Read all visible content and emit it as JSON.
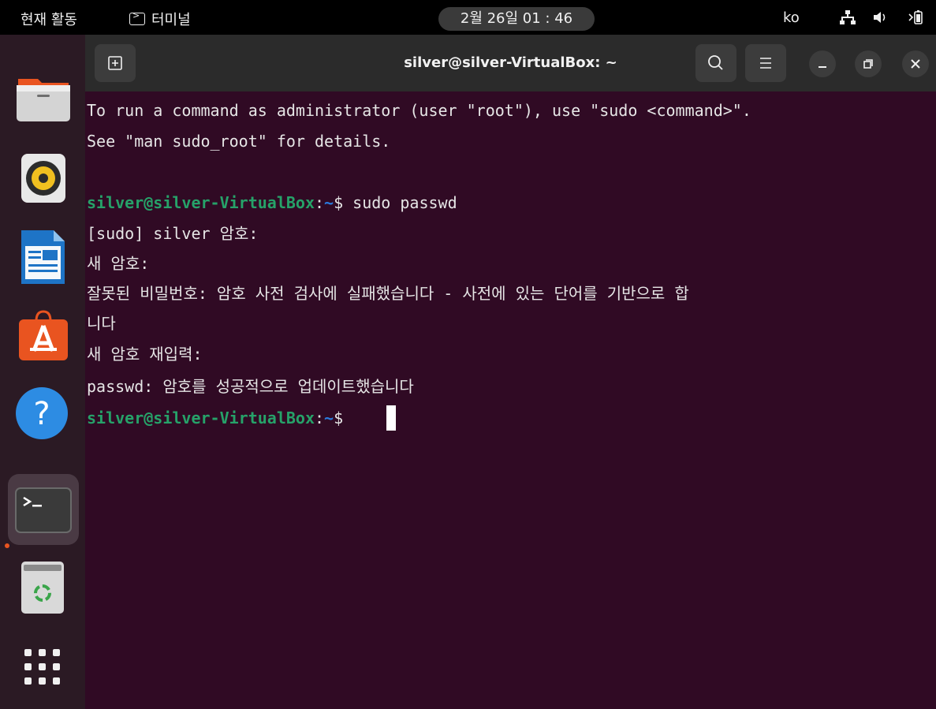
{
  "topbar": {
    "activities": "현재 활동",
    "app_name": "터미널",
    "clock": "2월 26일  01 : 46",
    "lang": "ko"
  },
  "window": {
    "title": "silver@silver-VirtualBox: ~"
  },
  "terminal": {
    "lines": [
      "To run a command as administrator (user \"root\"), use \"sudo <command>\".",
      "See \"man sudo_root\" for details.",
      "",
      "",
      "[sudo] silver 암호:",
      "새 암호:",
      "잘못된 비밀번호: 암호 사전 검사에 실패했습니다 - 사전에 있는 단어를 기반으로 합",
      "니다",
      "새 암호 재입력:",
      "passwd: 암호를 성공적으로 업데이트했습니다"
    ],
    "prompt1": {
      "user_host": "silver@silver-VirtualBox",
      "colon": ":",
      "path": "~",
      "symbol": "$ ",
      "command": "sudo passwd"
    },
    "prompt2": {
      "user_host": "silver@silver-VirtualBox",
      "colon": ":",
      "path": "~",
      "symbol": "$ "
    }
  },
  "colors": {
    "terminal_bg": "#300a24",
    "prompt_green": "#26a269",
    "prompt_blue": "#2a7bde",
    "accent_orange": "#e95420"
  },
  "dock": {
    "items": [
      "files-icon",
      "rhythmbox-icon",
      "writer-icon",
      "software-center-icon",
      "help-icon",
      "terminal-icon",
      "trash-icon",
      "app-grid-icon"
    ]
  }
}
